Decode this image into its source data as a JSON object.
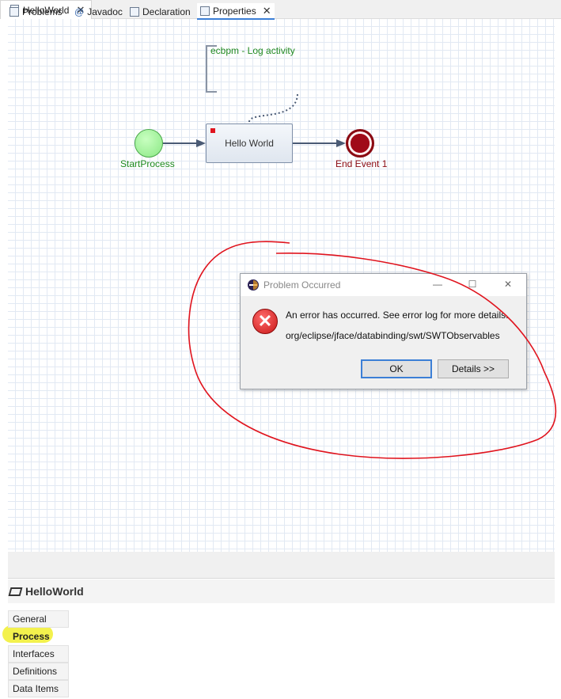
{
  "editor": {
    "tab_title": "HelloWorld"
  },
  "diagram": {
    "annotation": "ecbpm - Log activity",
    "start_label": "StartProcess",
    "task_label": "Hello World",
    "end_label": "End Event 1"
  },
  "dialog": {
    "title": "Problem Occurred",
    "message": "An error has occurred. See error log for more details.",
    "detail": "org/eclipse/jface/databinding/swt/SWTObservables",
    "ok_label": "OK",
    "details_label": "Details >>",
    "minimize": "—",
    "maximize": "☐",
    "close": "✕"
  },
  "views": {
    "tabs": [
      {
        "label": "Problems",
        "icon": "problems-icon"
      },
      {
        "label": "Javadoc",
        "icon": "at-icon"
      },
      {
        "label": "Declaration",
        "icon": "declaration-icon"
      },
      {
        "label": "Properties",
        "icon": "properties-icon",
        "active": true
      }
    ]
  },
  "properties": {
    "title": "HelloWorld",
    "tabs": [
      "General",
      "Process",
      "Interfaces",
      "Definitions",
      "Data Items"
    ],
    "selected_tab": "Process"
  },
  "colors": {
    "accent": "#3c7fd6",
    "annotation_red": "#e0141e",
    "highlight": "#f2f03a"
  }
}
